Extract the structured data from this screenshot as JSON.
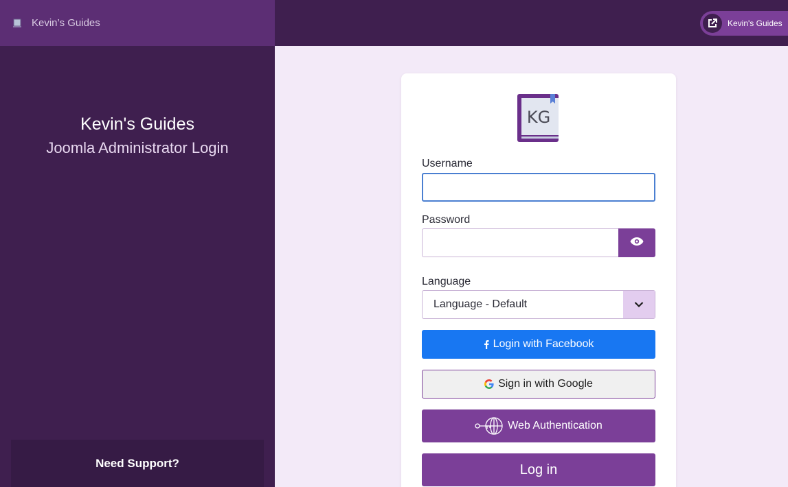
{
  "brand": {
    "name": "Kevin’s Guides",
    "icon": "joomla-book-icon"
  },
  "header": {
    "site_link_label": "Kevin's Guides",
    "site_link_icon": "external-link-icon"
  },
  "sidebar": {
    "title": "Kevin's Guides",
    "subtitle": "Joomla Administrator Login",
    "support_label": "Need Support?"
  },
  "login": {
    "logo_text": "KG",
    "username_label": "Username",
    "username_value": "",
    "password_label": "Password",
    "password_value": "",
    "password_toggle_icon": "eye-icon",
    "language_label": "Language",
    "language_value": "Language - Default",
    "facebook_label": "Login with Facebook",
    "google_label": "Sign in with Google",
    "webauthn_label": "Web Authentication",
    "login_label": "Log in"
  },
  "colors": {
    "primary": "#7b3f98",
    "sidebar": "#3f1f4f",
    "brand_bar": "#5c2e74",
    "facebook": "#1877f2",
    "page_background": "#f3eaf8"
  }
}
